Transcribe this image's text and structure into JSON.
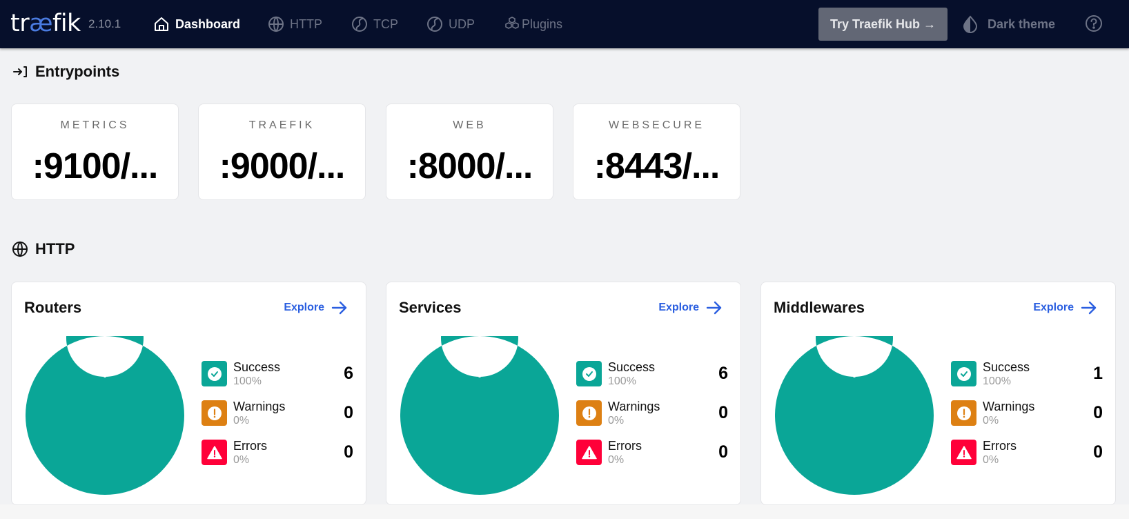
{
  "header": {
    "logo": {
      "pre": "tr",
      "ae": "æ",
      "post": "fik"
    },
    "version": "2.10.1",
    "nav": [
      {
        "label": "Dashboard",
        "icon": "home-icon",
        "active": true
      },
      {
        "label": "HTTP",
        "icon": "globe-icon",
        "active": false
      },
      {
        "label": "TCP",
        "icon": "tcp-icon",
        "active": false
      },
      {
        "label": "UDP",
        "icon": "udp-icon",
        "active": false
      },
      {
        "label": "Plugins",
        "icon": "plugins-icon",
        "active": false
      }
    ],
    "hub_button": "Try Traefik Hub →",
    "theme_toggle": "Dark theme",
    "help_icon": "help-icon"
  },
  "entrypoints": {
    "title": "Entrypoints",
    "icon": "entrypoint-icon",
    "items": [
      {
        "name": "METRICS",
        "address": ":9100/..."
      },
      {
        "name": "TRAEFIK",
        "address": ":9000/..."
      },
      {
        "name": "WEB",
        "address": ":8000/..."
      },
      {
        "name": "WEBSECURE",
        "address": ":8443/..."
      }
    ]
  },
  "http": {
    "title": "HTTP",
    "icon": "globe-icon",
    "explore_label": "Explore",
    "legend_labels": {
      "success": "Success",
      "warnings": "Warnings",
      "errors": "Errors"
    },
    "cards": [
      {
        "title": "Routers",
        "success": {
          "count": "6",
          "pct": "100%"
        },
        "warnings": {
          "count": "0",
          "pct": "0%"
        },
        "errors": {
          "count": "0",
          "pct": "0%"
        }
      },
      {
        "title": "Services",
        "success": {
          "count": "6",
          "pct": "100%"
        },
        "warnings": {
          "count": "0",
          "pct": "0%"
        },
        "errors": {
          "count": "0",
          "pct": "0%"
        }
      },
      {
        "title": "Middlewares",
        "success": {
          "count": "1",
          "pct": "100%"
        },
        "warnings": {
          "count": "0",
          "pct": "0%"
        },
        "errors": {
          "count": "0",
          "pct": "0%"
        }
      }
    ]
  },
  "colors": {
    "header_bg": "#060f2b",
    "accent": "#2a5ee0",
    "success": "#0aa697",
    "warning": "#dd8013",
    "error": "#ff0039"
  },
  "chart_data": [
    {
      "type": "pie",
      "title": "Routers",
      "categories": [
        "Success",
        "Warnings",
        "Errors"
      ],
      "values": [
        6,
        0,
        0
      ],
      "colors": [
        "#0aa697",
        "#dd8013",
        "#ff0039"
      ]
    },
    {
      "type": "pie",
      "title": "Services",
      "categories": [
        "Success",
        "Warnings",
        "Errors"
      ],
      "values": [
        6,
        0,
        0
      ],
      "colors": [
        "#0aa697",
        "#dd8013",
        "#ff0039"
      ]
    },
    {
      "type": "pie",
      "title": "Middlewares",
      "categories": [
        "Success",
        "Warnings",
        "Errors"
      ],
      "values": [
        1,
        0,
        0
      ],
      "colors": [
        "#0aa697",
        "#dd8013",
        "#ff0039"
      ]
    }
  ]
}
